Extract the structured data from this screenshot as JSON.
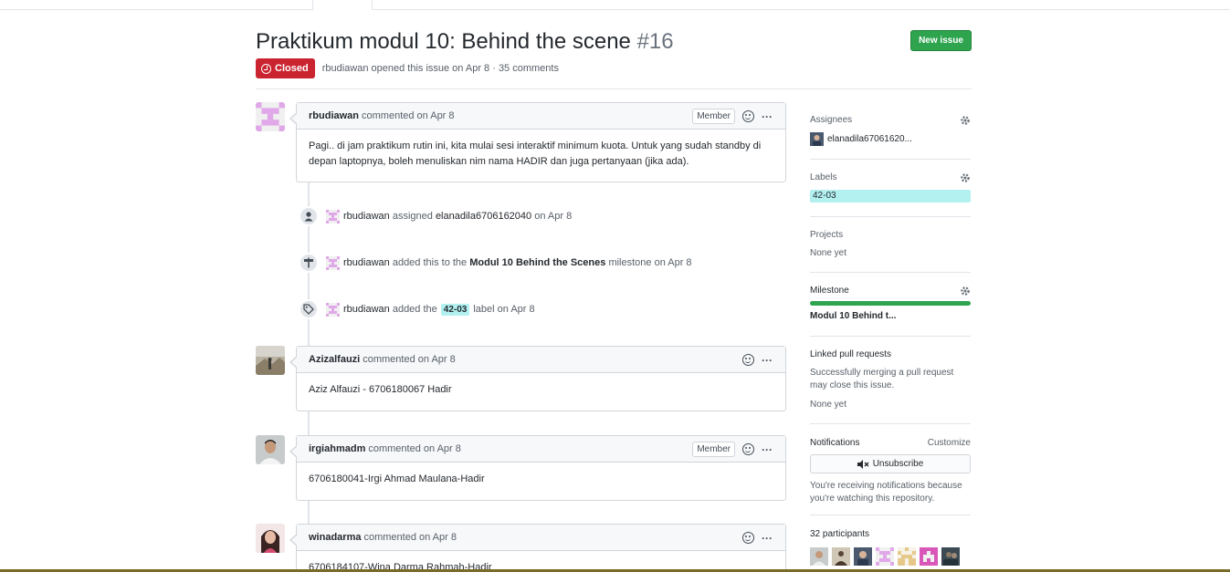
{
  "issue": {
    "title": "Praktikum modul 10: Behind the scene",
    "number": "#16",
    "state": "Closed",
    "new_issue_label": "New issue",
    "opened_by": "rbudiawan",
    "opened_meta": "opened this issue on Apr 8 · 35 comments"
  },
  "comments": [
    {
      "author": "rbudiawan",
      "when": "commented on Apr 8",
      "badge": "Member",
      "body": "Pagi.. di jam praktikum rutin ini, kita mulai sesi interaktif minimum kuota. Untuk yang sudah standby di depan laptopnya, boleh menuliskan nim nama HADIR dan juga pertanyaan (jika ada)."
    },
    {
      "author": "Azizalfauzi",
      "when": "commented on Apr 8",
      "body": "Aziz Alfauzi - 6706180067 Hadir"
    },
    {
      "author": "irgiahmadm",
      "when": "commented on Apr 8",
      "badge": "Member",
      "body": "6706180041-Irgi Ahmad Maulana-Hadir"
    },
    {
      "author": "winadarma",
      "when": "commented on Apr 8",
      "body": "6706184107-Wina Darma Rahmah-Hadir"
    }
  ],
  "events": [
    {
      "author": "rbudiawan",
      "pre": "assigned",
      "strong": "elanadila6706162040",
      "post": "on Apr 8"
    },
    {
      "author": "rbudiawan",
      "pre": "added this to the",
      "strong": "Modul 10 Behind the Scenes",
      "post": "milestone on Apr 8"
    },
    {
      "author": "rbudiawan",
      "pre": "added the",
      "label": "42-03",
      "post": "label on Apr 8"
    }
  ],
  "sidebar": {
    "assignees_title": "Assignees",
    "assignee": "elanadila67061620...",
    "labels_title": "Labels",
    "label": "42-03",
    "projects_title": "Projects",
    "projects_value": "None yet",
    "milestone_title": "Milestone",
    "milestone_value": "Modul 10 Behind t...",
    "milestone_progress": 1.0,
    "linked_title": "Linked pull requests",
    "linked_desc": "Successfully merging a pull request may close this issue.",
    "linked_value": "None yet",
    "notifications_title": "Notifications",
    "customize": "Customize",
    "unsubscribe": "Unsubscribe",
    "notif_desc": "You're receiving notifications because you're watching this repository.",
    "participants_title": "32 participants"
  },
  "colors": {
    "closed": "#cb2431",
    "green": "#2ea44f",
    "label": "#b3f0f0",
    "identicon": "#e8b4e8"
  }
}
